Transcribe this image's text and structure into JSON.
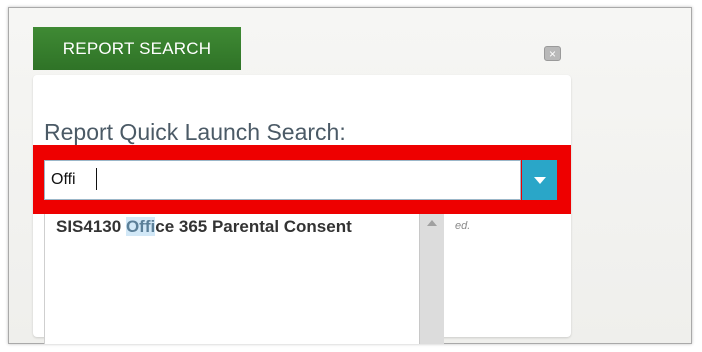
{
  "dialog": {
    "tab_label": "REPORT SEARCH",
    "close_symbol": "×",
    "close_icon": "close-icon"
  },
  "search": {
    "title": "Report Quick Launch Search:",
    "value": "Offi",
    "dropdown_icon": "chevron-down-icon"
  },
  "results": {
    "items": [
      {
        "prefix": "SIS4130 ",
        "match": "Offi",
        "suffix": "ce 365 Parental Consent"
      }
    ],
    "hint_fragment": "ed."
  },
  "colors": {
    "tab_green": "#2f7327",
    "highlight_red": "#ee0000",
    "dropdown_teal": "#2aa6c8",
    "match_highlight": "#d2e8f7"
  }
}
